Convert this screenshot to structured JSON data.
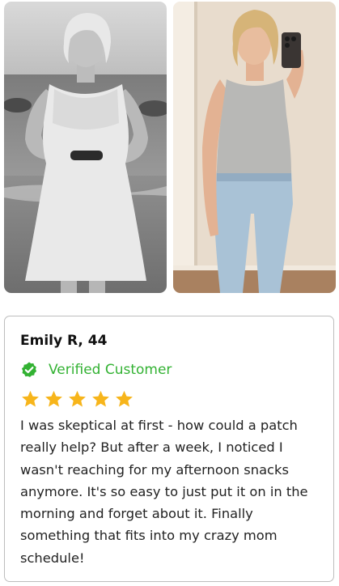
{
  "testimonial": {
    "name": "Emily R, 44",
    "verified_label": "Verified Customer",
    "rating": 5,
    "rating_max": 5,
    "review": "I was skeptical at first - how could a patch really help? But after a week, I noticed I wasn't reaching for my afternoon snacks anymore. It's so easy to just put it on in the morning and forget about it. Finally something that fits into my crazy mom schedule!"
  },
  "icons": {
    "verified": "check-badge-icon",
    "rating": "star-icon"
  },
  "colors": {
    "verified_green": "#33b233",
    "star_gold": "#f7b51b",
    "card_border": "#bdbdbd"
  }
}
